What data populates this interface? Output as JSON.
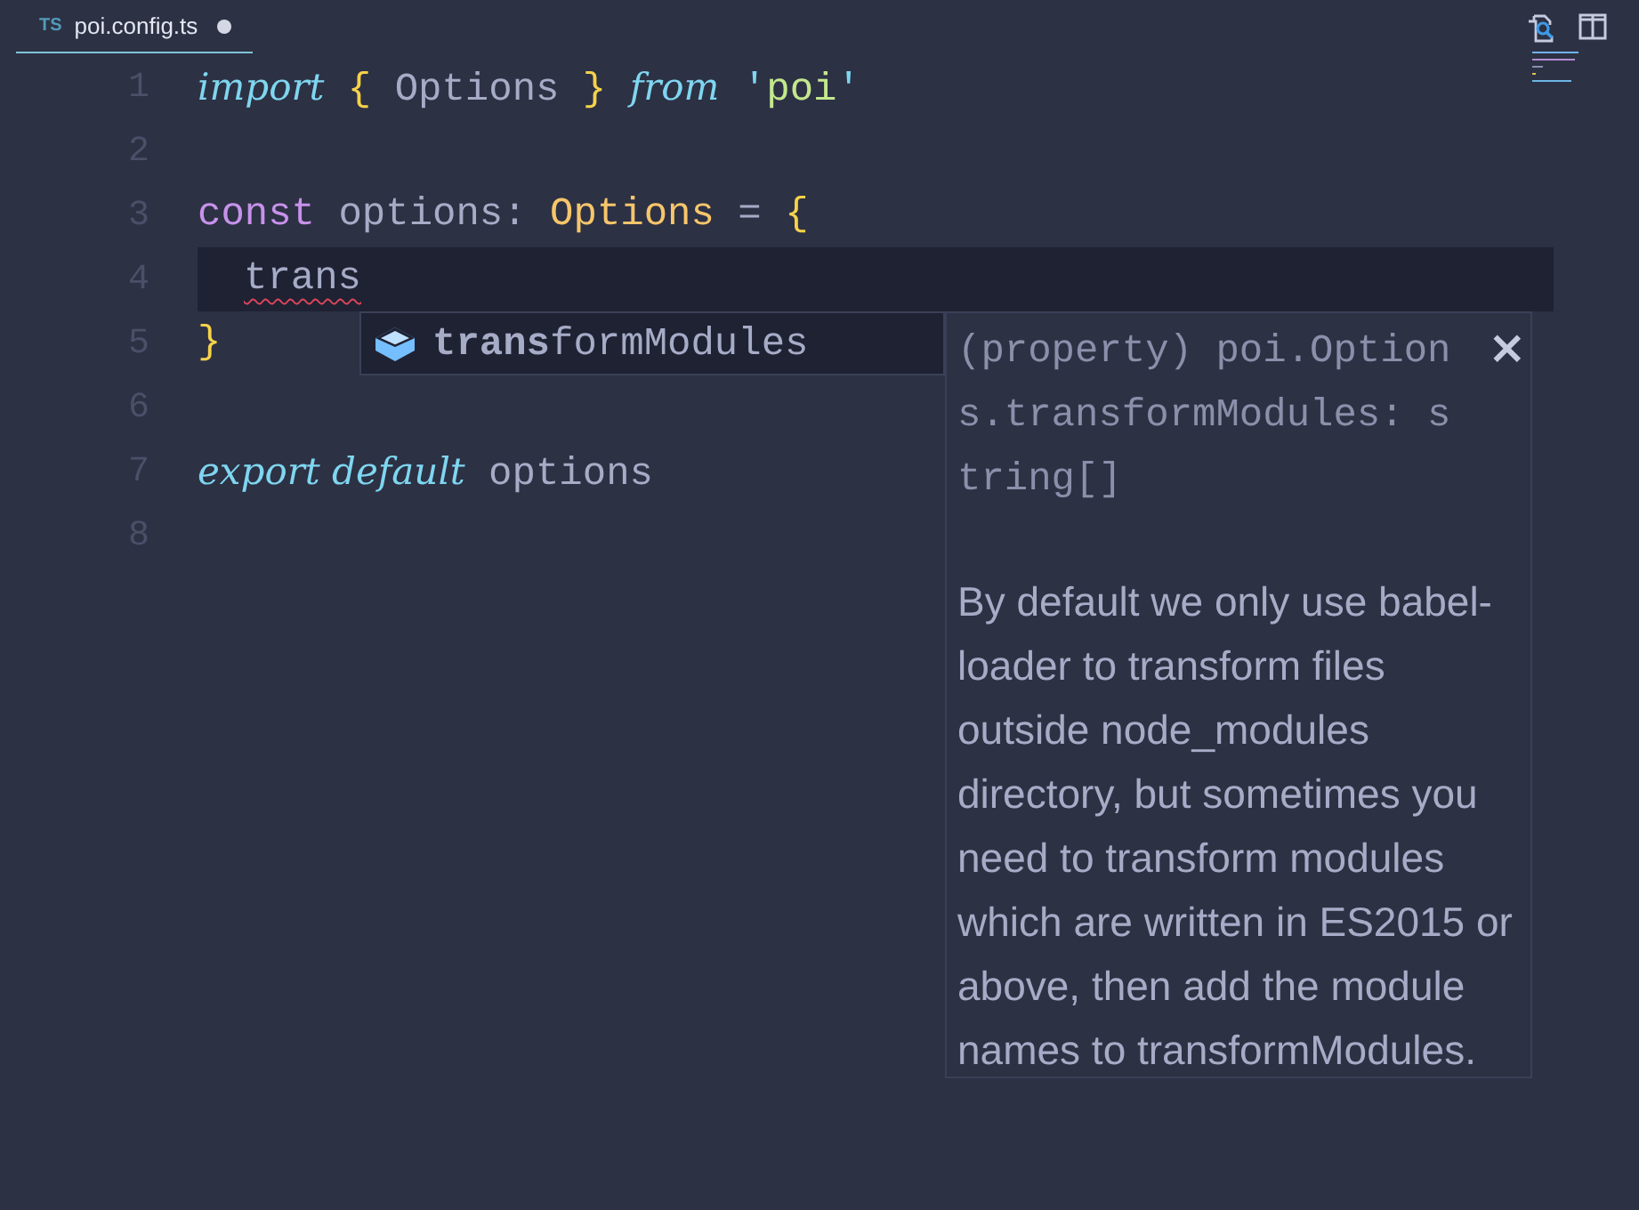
{
  "tab": {
    "badge": "TS",
    "title": "poi.config.ts",
    "modified": true,
    "selected": true
  },
  "editor": {
    "lines": [
      {
        "number": "1",
        "tokens": [
          {
            "kind": "keyword",
            "text": "import"
          },
          {
            "kind": "brace",
            "text": " { "
          },
          {
            "kind": "ident",
            "text": "Options"
          },
          {
            "kind": "brace",
            "text": " } "
          },
          {
            "kind": "keyword",
            "text": "from"
          },
          {
            "kind": "quote",
            "text": " '"
          },
          {
            "kind": "string",
            "text": "poi"
          },
          {
            "kind": "quote",
            "text": "'"
          }
        ]
      },
      {
        "number": "2"
      },
      {
        "number": "3",
        "tokens": [
          {
            "kind": "storage",
            "text": "const"
          },
          {
            "kind": "ident",
            "text": " options: "
          },
          {
            "kind": "type",
            "text": "Options"
          },
          {
            "kind": "ident",
            "text": " = "
          },
          {
            "kind": "brace",
            "text": "{"
          }
        ]
      },
      {
        "number": "4",
        "current": true,
        "indented": true,
        "tokens": [
          {
            "kind": "ident",
            "text": "trans",
            "error": true
          }
        ]
      },
      {
        "number": "5",
        "tokens": [
          {
            "kind": "brace",
            "text": "}"
          }
        ]
      },
      {
        "number": "6"
      },
      {
        "number": "7",
        "tokens": [
          {
            "kind": "keyword",
            "text": "export "
          },
          {
            "kind": "keyword",
            "text": "default"
          },
          {
            "kind": "ident",
            "text": " options"
          }
        ]
      },
      {
        "number": "8"
      }
    ]
  },
  "suggestion": {
    "label": "**trans**formModules",
    "selected": true
  },
  "details": {
    "signature": "(property) poi.Options.transformModules: string[]",
    "close": "×",
    "description": "By default we only use babel-loader to transform files outside node_modules directory, but sometimes you need to transform modules which are written in ES2015 or above, then add the module names to transformModules."
  }
}
